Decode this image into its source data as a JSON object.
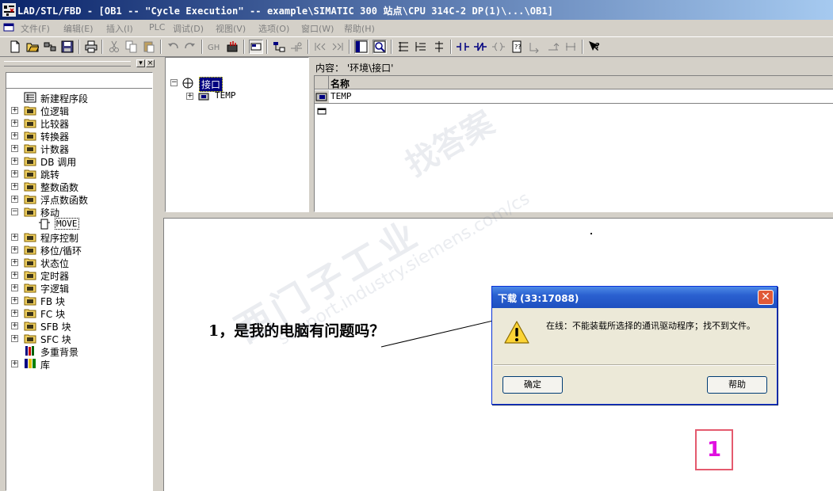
{
  "window": {
    "title": "LAD/STL/FBD  - [OB1 -- \"Cycle Execution\" -- example\\SIMATIC 300 站点\\CPU 314C-2 DP(1)\\...\\OB1]"
  },
  "menu": {
    "items": [
      "文件(F)",
      "编辑(E)",
      "插入(I)",
      "PLC",
      "调试(D)",
      "视图(V)",
      "选项(O)",
      "窗口(W)",
      "帮助(H)"
    ]
  },
  "toolbar": {
    "icons": [
      "new-icon",
      "open-icon",
      "accessible-nodes-icon",
      "save-icon",
      "print-icon",
      "cut-icon",
      "copy-icon",
      "paste-icon",
      "undo-icon",
      "redo-icon",
      "download-icon",
      "monitor-icon",
      "overview-icon",
      "network-icon",
      "branch-icon",
      "prev-icon",
      "next-icon",
      "window-icon",
      "zoom-icon",
      "normally-open-icon",
      "normally-closed-icon",
      "coil-icon",
      "box-icon",
      "help-icon"
    ]
  },
  "left_tree": {
    "items": [
      {
        "label": "新建程序段",
        "icon": "network-icon",
        "expander": ""
      },
      {
        "label": "位逻辑",
        "icon": "bit-logic-icon",
        "expander": "+"
      },
      {
        "label": "比较器",
        "icon": "comparator-icon",
        "expander": "+"
      },
      {
        "label": "转换器",
        "icon": "converter-icon",
        "expander": "+"
      },
      {
        "label": "计数器",
        "icon": "counter-icon",
        "expander": "+"
      },
      {
        "label": "DB 调用",
        "icon": "db-call-icon",
        "expander": "+"
      },
      {
        "label": "跳转",
        "icon": "jump-icon",
        "expander": "+"
      },
      {
        "label": "整数函数",
        "icon": "integer-icon",
        "expander": "+"
      },
      {
        "label": "浮点数函数",
        "icon": "float-icon",
        "expander": "+"
      },
      {
        "label": "移动",
        "icon": "move-folder-icon",
        "expander": "-"
      },
      {
        "label": "MOVE",
        "icon": "move-box-icon",
        "expander": "",
        "child": true
      },
      {
        "label": "程序控制",
        "icon": "program-control-icon",
        "expander": "+"
      },
      {
        "label": "移位/循环",
        "icon": "shift-icon",
        "expander": "+"
      },
      {
        "label": "状态位",
        "icon": "status-bit-icon",
        "expander": "+"
      },
      {
        "label": "定时器",
        "icon": "timer-icon",
        "expander": "+"
      },
      {
        "label": "字逻辑",
        "icon": "word-logic-icon",
        "expander": "+"
      },
      {
        "label": "FB 块",
        "icon": "fb-block-icon",
        "expander": "+"
      },
      {
        "label": "FC 块",
        "icon": "fc-block-icon",
        "expander": "+"
      },
      {
        "label": "SFB 块",
        "icon": "sfb-block-icon",
        "expander": "+"
      },
      {
        "label": "SFC 块",
        "icon": "sfc-block-icon",
        "expander": "+"
      },
      {
        "label": "多重背景",
        "icon": "multi-instance-icon",
        "expander": ""
      },
      {
        "label": "库",
        "icon": "library-icon",
        "expander": "+"
      }
    ]
  },
  "interface_tree": {
    "root": "接口",
    "child": "TEMP"
  },
  "content": {
    "label": "内容：  '环境\\接口'",
    "column_header": "名称",
    "rows": [
      "TEMP"
    ]
  },
  "editor": {
    "annotation": "1，是我的电脑有问题吗？",
    "badge": "1"
  },
  "watermark": {
    "line1": "西门子工业",
    "line2": "support.industry.siemens.com/cs",
    "line3": "找答案"
  },
  "dialog": {
    "title": "下载  (33:17088)",
    "message": "在线：不能装载所选择的通讯驱动程序；找不到文件。",
    "ok_label": "确定",
    "help_label": "帮助"
  },
  "colors": {
    "title_bar_start": "#0a246a",
    "title_bar_end": "#a6caf0",
    "dialog_title": "#2a60d0",
    "badge_border": "#e45a6e",
    "badge_text": "#e010e0"
  }
}
